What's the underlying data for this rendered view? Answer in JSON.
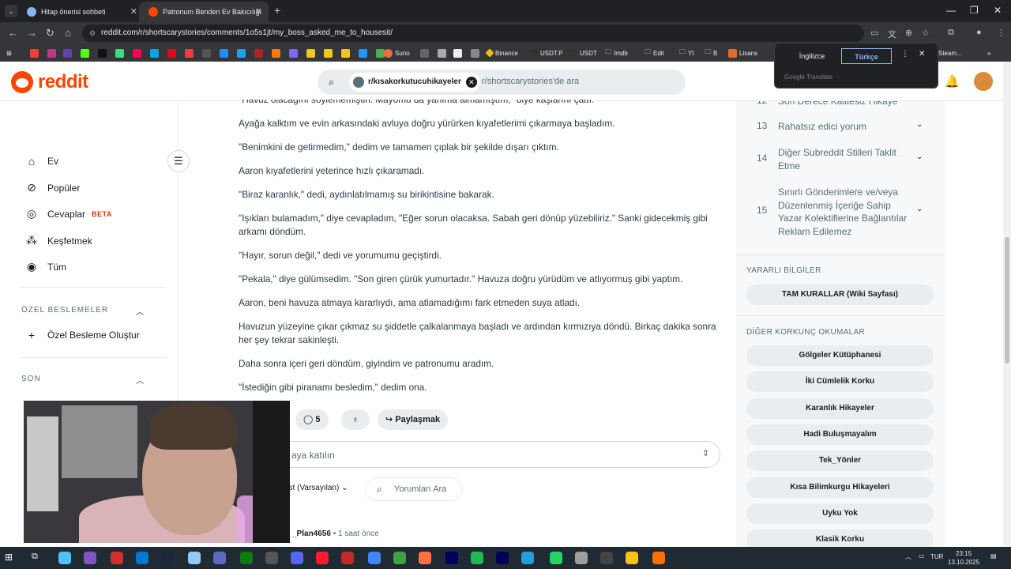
{
  "browser": {
    "tabs": [
      {
        "title": "Hitap önerisi sohbeti",
        "color": "#8ab4f8"
      },
      {
        "title": "Patronum Benden Ev Bakıcılığı",
        "color": "#ff4500"
      }
    ],
    "url": "reddit.com/r/shortscarystories/comments/1o5s1jt/my_boss_asked_me_to_housesit/",
    "bookmarks": [
      {
        "label": "Suno",
        "color": "#f26b3a"
      },
      {
        "label": "Binance",
        "color": "#f0b90b"
      },
      {
        "label": "USDT.P",
        "color": "#444"
      },
      {
        "label": "USDT",
        "color": "#444"
      },
      {
        "label": "İmdb",
        "color": "#888"
      },
      {
        "label": "Edit",
        "color": "#888"
      },
      {
        "label": "Yt",
        "color": "#888"
      },
      {
        "label": "B",
        "color": "#888"
      },
      {
        "label": "Lisans",
        "color": "#e06c2d"
      },
      {
        "label": "Steam...",
        "color": "#888"
      }
    ]
  },
  "translate": {
    "option_source": "İngilizce",
    "option_target": "Türkçe",
    "brand": "Google Translate"
  },
  "header": {
    "logo": "reddit",
    "search_chip": "r/kısakorkutucuhikayeler",
    "search_placeholder": "r/shortscarystories'de ara"
  },
  "leftnav": {
    "items": [
      {
        "label": "Ev",
        "icon": "home-icon"
      },
      {
        "label": "Popüler",
        "icon": "popular-icon"
      },
      {
        "label": "Cevaplar",
        "icon": "answers-icon",
        "badge": "BETA"
      },
      {
        "label": "Keşfetmek",
        "icon": "explore-icon"
      },
      {
        "label": "Tüm",
        "icon": "all-icon"
      }
    ],
    "custom_feeds_title": "ÖZEL BESLEMELER",
    "create_feed": "Özel Besleme Oluştur",
    "recent_title": "SON"
  },
  "post": {
    "paragraphs": [
      "\"Havuz olacağını söylememiştin. Mayomu da yanıma almamıştım,\" diye kaşlarını çattı.",
      "Ayağa kalktım ve evin arkasındaki avluya doğru yürürken kıyafetlerimi çıkarmaya başladım.",
      "\"Benimkini de getirmedim,\" dedim ve tamamen çıplak bir şekilde dışarı çıktım.",
      "Aaron kıyafetlerini yeterince hızlı çıkaramadı.",
      "\"Biraz karanlık,\" dedi, aydınlatılmamış su birikintisine bakarak.",
      "\"Işıkları bulamadım,\" diye cevapladım, \"Eğer sorun olacaksa. Sabah geri dönüp yüzebiliriz.\" Sanki gidecekmiş gibi arkamı döndüm.",
      "\"Hayır, sorun değil,\" dedi ve yorumumu geçiştirdi.",
      "\"Pekala,\" diye gülümsedim. \"Son giren çürük yumurtadır.\" Havuza doğru yürüdüm ve atlıyormuş gibi yaptım.",
      "Aaron, beni havuza atmaya kararlıydı, ama atlamadığımı fark etmeden suya atladı.",
      "Havuzun yüzeyine çıkar çıkmaz su şiddetle çalkalanmaya başladı ve ardından kırmızıya döndü. Birkaç dakika sonra her şey tekrar sakinleşti.",
      "Daha sonra içeri geri döndüm, giyindim ve patronumu aradım.",
      "\"İstediğin gibi piranamı besledim,\" dedim ona."
    ],
    "comment_count": "5",
    "share_label": "Paylaşmak",
    "comment_placeholder": "aya katılın",
    "sort_label": "üst (Varsayılan)",
    "comment_search": "Yorumları Ara",
    "first_commenter": "_Plan4656",
    "first_comment_time": "1 saat önce"
  },
  "rightbar": {
    "rules": [
      {
        "num": "12",
        "text": "Son Derece Kalitesiz Hikaye"
      },
      {
        "num": "13",
        "text": "Rahatsız edici yorum"
      },
      {
        "num": "14",
        "text": "Diğer Subreddit Stilleri Taklit Etme"
      },
      {
        "num": "15",
        "text": "Sınırlı Gönderimlere ve/veya Düzenlenmiş İçeriğe Sahip Yazar Kolektiflerine Bağlantılar Reklam Edilemez"
      }
    ],
    "useful_title": "YARARLI BİLGİLER",
    "useful_button": "TAM KURALLAR (Wiki Sayfası)",
    "other_title": "DİĞER KORKUNÇ OKUMALAR",
    "other_links": [
      "Gölgeler Kütüphanesi",
      "İki Cümlelik Korku",
      "Karanlık Hikayeler",
      "Hadi Buluşmayalım",
      "Tek_Yönler",
      "Kısa Bilimkurgu Hikayeleri",
      "Uyku Yok",
      "Klasik Korku"
    ]
  },
  "taskbar": {
    "language": "TUR",
    "time": "23:15",
    "date": "13.10.2025"
  }
}
